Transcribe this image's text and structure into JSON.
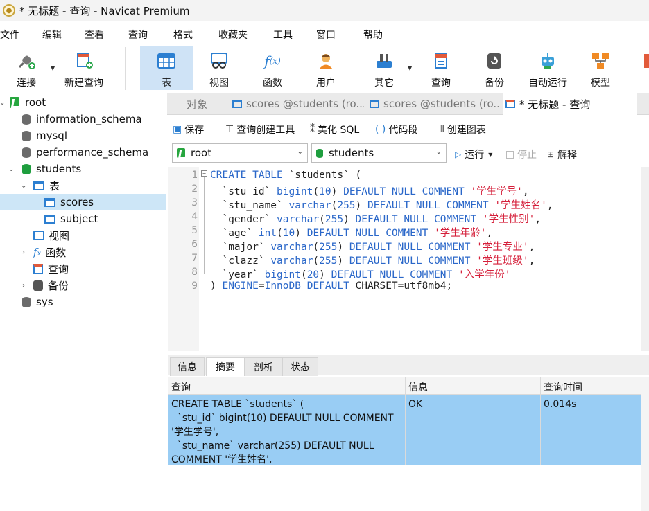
{
  "window": {
    "title": "* 无标题 - 查询 - Navicat Premium"
  },
  "menu": [
    "文件",
    "编辑",
    "查看",
    "查询",
    "格式",
    "收藏夹",
    "工具",
    "窗口",
    "帮助"
  ],
  "toolbar": {
    "connect": "连接",
    "new_query": "新建查询",
    "table": "表",
    "view": "视图",
    "function": "函数",
    "user": "用户",
    "other": "其它",
    "query": "查询",
    "backup": "备份",
    "automation": "自动运行",
    "model": "模型"
  },
  "tree": {
    "root": "root",
    "information_schema": "information_schema",
    "mysql": "mysql",
    "performance_schema": "performance_schema",
    "students": "students",
    "tables_group": "表",
    "scores": "scores",
    "subject": "subject",
    "views_group": "视图",
    "functions_group": "函数",
    "queries_group": "查询",
    "backups_group": "备份",
    "sys": "sys"
  },
  "tabs": {
    "objects": "对象",
    "tab1": "scores @students (ro...",
    "tab2": "scores @students (ro...",
    "tab3": "* 无标题 - 查询"
  },
  "query_toolbar": {
    "save": "保存",
    "query_builder": "查询创建工具",
    "beautify": "美化 SQL",
    "code_snippet": "代码段",
    "create_chart": "创建图表"
  },
  "connection_select": "root",
  "database_select": "students",
  "actions": {
    "run": "运行",
    "stop": "停止",
    "explain": "解释"
  },
  "editor": {
    "line_numbers": [
      "1",
      "2",
      "3",
      "4",
      "5",
      "6",
      "7",
      "8",
      "9"
    ]
  },
  "result_tabs": [
    "信息",
    "摘要",
    "剖析",
    "状态"
  ],
  "result": {
    "headers": [
      "查询",
      "信息",
      "查询时间"
    ],
    "query_lines": [
      "CREATE TABLE `students` (",
      "  `stu_id` bigint(10) DEFAULT NULL COMMENT",
      "'学生学号',",
      "  `stu_name` varchar(255) DEFAULT NULL",
      "COMMENT '学生姓名',"
    ],
    "info": "OK",
    "time": "0.014s"
  },
  "colors": {
    "selection": "#99cdf4",
    "keyword": "#2a67c9",
    "string": "#d51f3a",
    "active_tool": "#cfe3f6"
  }
}
